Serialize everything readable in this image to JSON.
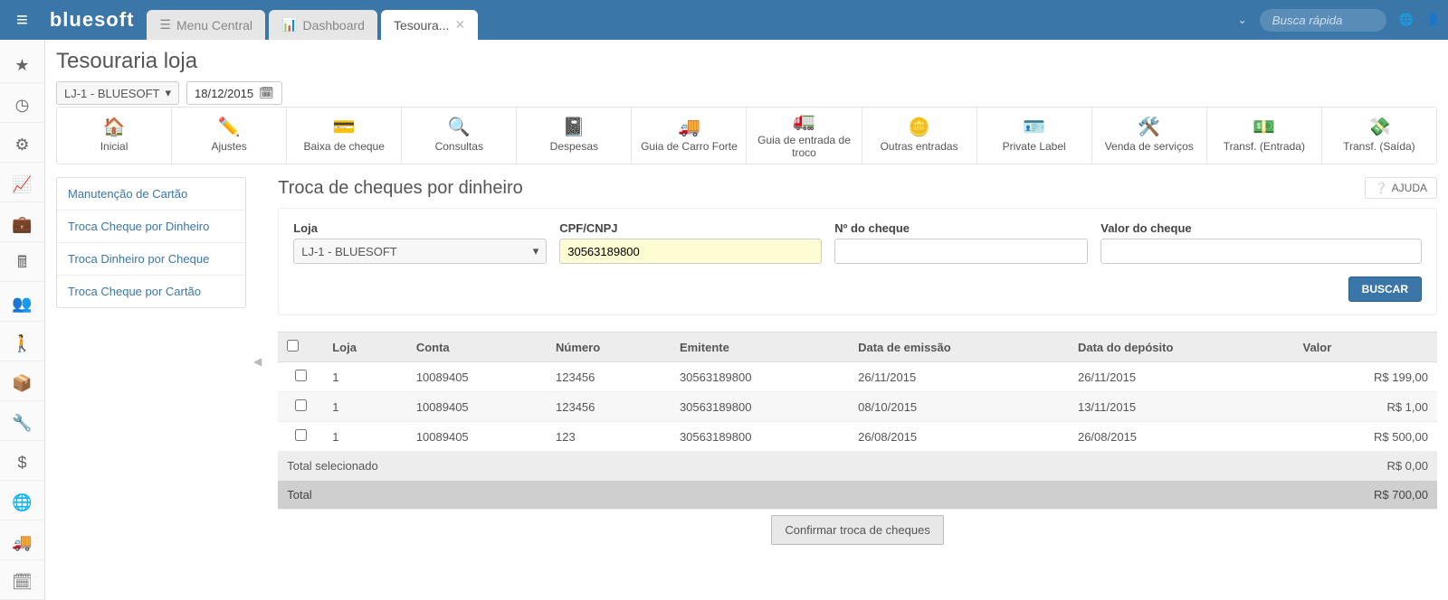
{
  "brand": "bluesoft",
  "top_tabs": [
    {
      "label": "Menu Central",
      "icon": "☰"
    },
    {
      "label": "Dashboard",
      "icon": "📊"
    },
    {
      "label": "Tesoura...",
      "icon": ""
    }
  ],
  "search_placeholder": "Busca rápida",
  "page_title": "Tesouraria loja",
  "store_selector": "LJ-1 - BLUESOFT",
  "date_value": "18/12/2015",
  "actions": [
    {
      "label": "Inicial",
      "icon": "🏠"
    },
    {
      "label": "Ajustes",
      "icon": "✏️"
    },
    {
      "label": "Baixa de cheque",
      "icon": "💳"
    },
    {
      "label": "Consultas",
      "icon": "🔍"
    },
    {
      "label": "Despesas",
      "icon": "📓"
    },
    {
      "label": "Guia de Carro Forte",
      "icon": "🚚"
    },
    {
      "label": "Guia de entrada de troco",
      "icon": "🚛"
    },
    {
      "label": "Outras entradas",
      "icon": "🪙"
    },
    {
      "label": "Private Label",
      "icon": "🪪"
    },
    {
      "label": "Venda de serviços",
      "icon": "🛠️"
    },
    {
      "label": "Transf. (Entrada)",
      "icon": "💵"
    },
    {
      "label": "Transf. (Saída)",
      "icon": "💸"
    }
  ],
  "side_menu": [
    "Manutenção de Cartão",
    "Troca Cheque por Dinheiro",
    "Troca Dinheiro por Cheque",
    "Troca Cheque por Cartão"
  ],
  "panel_title": "Troca de cheques por dinheiro",
  "help_label": "AJUDA",
  "filters": {
    "loja_label": "Loja",
    "loja_value": "LJ-1 - BLUESOFT",
    "cpf_label": "CPF/CNPJ",
    "cpf_value": "30563189800",
    "numero_label": "Nº do cheque",
    "numero_value": "",
    "valor_label": "Valor do cheque",
    "valor_value": ""
  },
  "buscar_label": "BUSCAR",
  "columns": {
    "loja": "Loja",
    "conta": "Conta",
    "numero": "Número",
    "emitente": "Emitente",
    "emissao": "Data de emissão",
    "deposito": "Data do depósito",
    "valor": "Valor"
  },
  "rows": [
    {
      "loja": "1",
      "conta": "10089405",
      "numero": "123456",
      "emitente": "30563189800",
      "emissao": "26/11/2015",
      "deposito": "26/11/2015",
      "valor": "R$ 199,00"
    },
    {
      "loja": "1",
      "conta": "10089405",
      "numero": "123456",
      "emitente": "30563189800",
      "emissao": "08/10/2015",
      "deposito": "13/11/2015",
      "valor": "R$ 1,00"
    },
    {
      "loja": "1",
      "conta": "10089405",
      "numero": "123",
      "emitente": "30563189800",
      "emissao": "26/08/2015",
      "deposito": "26/08/2015",
      "valor": "R$ 500,00"
    }
  ],
  "totals": {
    "selected_label": "Total selecionado",
    "selected_value": "R$ 0,00",
    "total_label": "Total",
    "total_value": "R$ 700,00"
  },
  "confirm_label": "Confirmar troca de cheques",
  "rail_icons": [
    "★",
    "◷",
    "⚙",
    "📈",
    "💼",
    "🖩",
    "👥",
    "🚶",
    "📦",
    "🔧",
    "$",
    "🌐",
    "🚚",
    "🗓"
  ]
}
